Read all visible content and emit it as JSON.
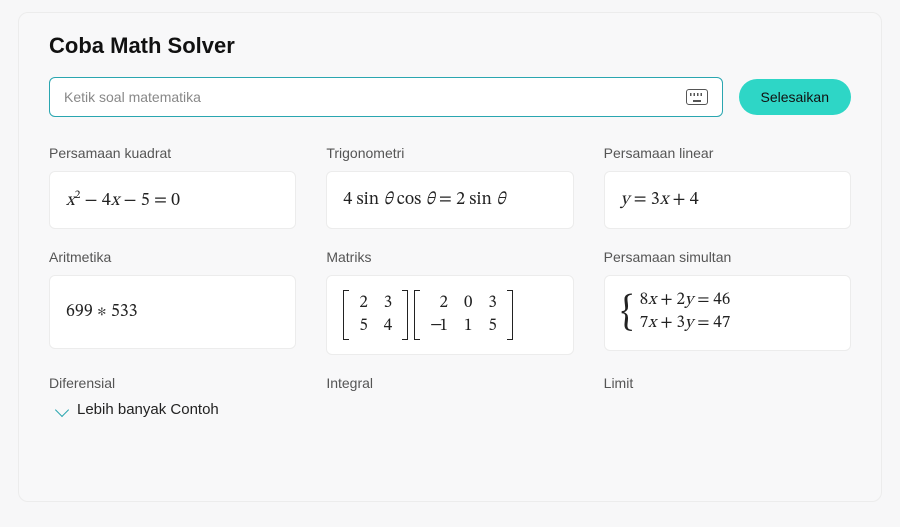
{
  "title": "Coba Math Solver",
  "search": {
    "placeholder": "Ketik soal matematika",
    "value": ""
  },
  "solve_button": "Selesaikan",
  "categories": [
    {
      "label": "Persamaan kuadrat",
      "expr_key": "quad"
    },
    {
      "label": "Trigonometri",
      "expr_key": "trig"
    },
    {
      "label": "Persamaan linear",
      "expr_key": "linear"
    },
    {
      "label": "Aritmetika",
      "expr_key": "arith"
    },
    {
      "label": "Matriks",
      "expr_key": "matrix"
    },
    {
      "label": "Persamaan simultan",
      "expr_key": "sim"
    },
    {
      "label": "Diferensial",
      "expr_key": null
    },
    {
      "label": "Integral",
      "expr_key": null
    },
    {
      "label": "Limit",
      "expr_key": null
    }
  ],
  "expressions": {
    "quad": "x² − 4x − 5 = 0",
    "trig": "4 sin θ cos θ = 2 sin θ",
    "linear": "y = 3x + 4",
    "arith": "699 ∗ 533",
    "matrix": {
      "a": [
        [
          2,
          3
        ],
        [
          5,
          4
        ]
      ],
      "b": [
        [
          2,
          0,
          3
        ],
        [
          -1,
          1,
          5
        ]
      ]
    },
    "sim": [
      "8x + 2y = 46",
      "7x + 3y = 47"
    ]
  },
  "more_examples": "Lebih banyak Contoh"
}
